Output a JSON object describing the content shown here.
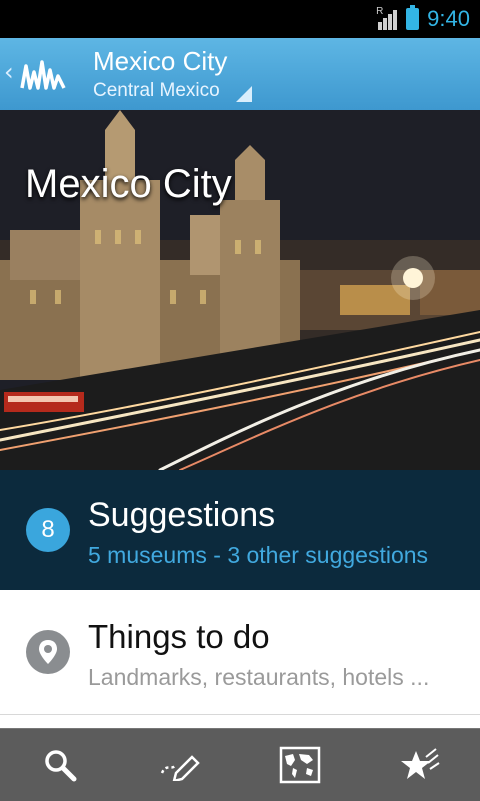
{
  "status_bar": {
    "time": "9:40",
    "roaming_label": "R"
  },
  "action_bar": {
    "title": "Mexico City",
    "subtitle": "Central Mexico",
    "logo_icon": "city-skyline-icon",
    "accent_color": "#3e98cf"
  },
  "hero": {
    "title": "Mexico City"
  },
  "suggestions": {
    "count": "8",
    "title": "Suggestions",
    "subtitle": "5 museums - 3 other suggestions",
    "background_color": "#0c2a3d",
    "accent_color": "#41a9df"
  },
  "things_to_do": {
    "title": "Things to do",
    "subtitle": "Landmarks, restaurants, hotels ...",
    "icon": "map-pin-icon"
  },
  "bottom_tabs": [
    {
      "icon": "search-icon"
    },
    {
      "icon": "edit-trip-icon"
    },
    {
      "icon": "world-map-icon"
    },
    {
      "icon": "favorites-star-icon"
    }
  ]
}
